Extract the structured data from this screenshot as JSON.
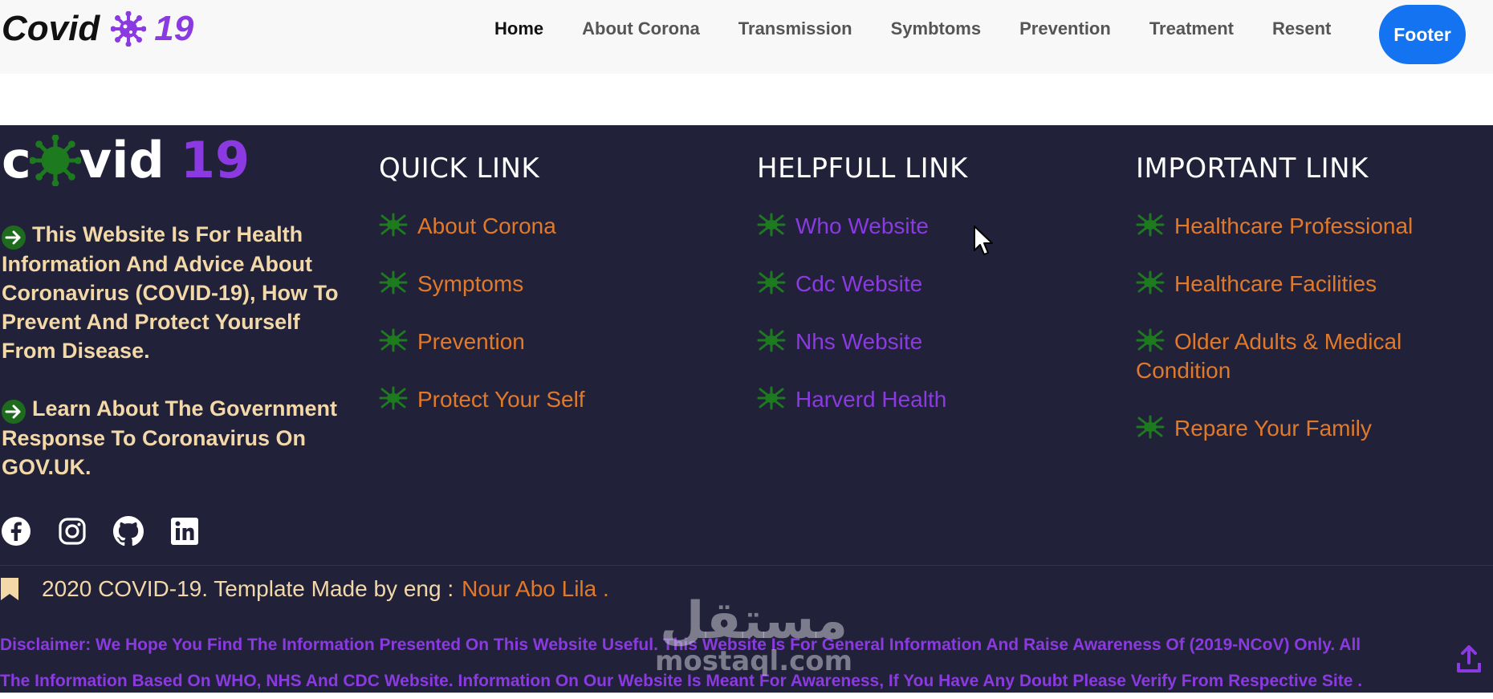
{
  "brand": {
    "word": "Covid",
    "number": "19"
  },
  "nav": {
    "items": [
      "Home",
      "About Corona",
      "Transmission",
      "Symbtoms",
      "Prevention",
      "Treatment",
      "Resent"
    ],
    "active": "Home",
    "button_label": "Footer"
  },
  "footer": {
    "logo": {
      "c": "c",
      "rest": "vid",
      "number": "19"
    },
    "about": [
      "This Website Is For Health Information And Advice About Coronavirus (COVID-19), How To Prevent And Protect Yourself From Disease.",
      "Learn About The Government Response To Coronavirus On GOV.UK."
    ],
    "quick": {
      "title": "QUICK LINK",
      "links": [
        "About Corona",
        "Symptoms",
        "Prevention",
        "Protect Your Self"
      ]
    },
    "helpful": {
      "title": "HELPFULL LINK",
      "links": [
        "Who Website",
        "Cdc Website",
        "Nhs Website",
        "Harverd Health"
      ]
    },
    "important": {
      "title": "IMPORTANT LINK",
      "links": [
        "Healthcare Professional",
        "Healthcare Facilities",
        "Older Adults & Medical Condition",
        "Repare Your Family"
      ]
    },
    "social": [
      "facebook-icon",
      "instagram-icon",
      "github-icon",
      "linkedin-icon"
    ],
    "copyright": {
      "text": "2020 COVID-19. Template Made by eng :",
      "author": "Nour Abo Lila ."
    },
    "disclaimer": [
      "Disclaimer: We Hope You Find The Information Presented On This Website Useful. This Website Is For General Information And Raise Awareness Of (2019-NCoV) Only. All",
      "The Information Based On WHO, NHS And CDC Website. Information On Our Website Is Meant For Awareness, If You Have Any Doubt Please Verify From Respective Site ."
    ]
  },
  "colors": {
    "purple": "#8a3ae0",
    "orange": "#e07a2a",
    "green": "#1e6b1e",
    "dark": "#22213a",
    "blue": "#1473f0",
    "cream": "#f3d9a8"
  },
  "watermark": {
    "arabic": "مستقل",
    "latin": "mostaql.com"
  }
}
